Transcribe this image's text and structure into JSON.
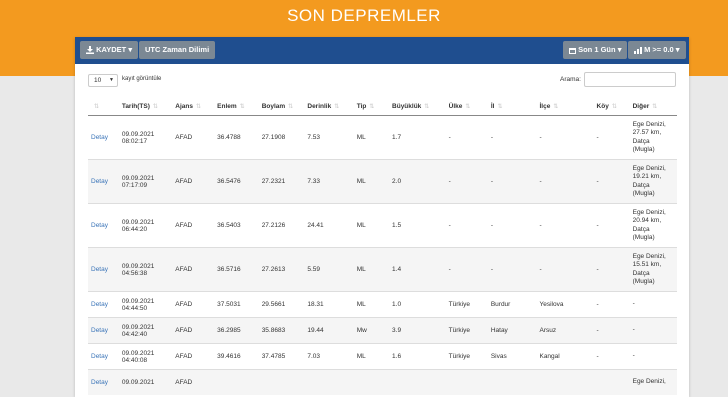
{
  "header": {
    "title": "SON DEPREMLER"
  },
  "toolbar": {
    "save_label": "KAYDET",
    "utc_label": "UTC Zaman Dilimi",
    "time_filter_label": "Son 1 Gün",
    "mag_filter_label": "M >= 0.0"
  },
  "controls": {
    "page_length": "10",
    "page_length_label": "kayıt görüntüle",
    "search_label": "Arama:",
    "search_value": ""
  },
  "table": {
    "columns": [
      "",
      "Tarih(TS)",
      "Ajans",
      "Enlem",
      "Boylam",
      "Derinlik",
      "Tip",
      "Büyüklük",
      "Ülke",
      "İl",
      "İlçe",
      "Köy",
      "Diğer"
    ],
    "rows": [
      {
        "link": "Detay",
        "date": "09.09.2021",
        "time": "08:02:17",
        "agency": "AFAD",
        "lat": "36.4788",
        "lon": "27.1908",
        "depth": "7.53",
        "type": "ML",
        "mag": "1.7",
        "country": "-",
        "province": "-",
        "district": "-",
        "village": "-",
        "other": [
          "Ege Denizi,",
          "27.57 km,",
          "Datça",
          "(Mugla)"
        ]
      },
      {
        "link": "Detay",
        "date": "09.09.2021",
        "time": "07:17:09",
        "agency": "AFAD",
        "lat": "36.5476",
        "lon": "27.2321",
        "depth": "7.33",
        "type": "ML",
        "mag": "2.0",
        "country": "-",
        "province": "-",
        "district": "-",
        "village": "-",
        "other": [
          "Ege Denizi,",
          "19.21 km,",
          "Datça",
          "(Mugla)"
        ]
      },
      {
        "link": "Detay",
        "date": "09.09.2021",
        "time": "06:44:20",
        "agency": "AFAD",
        "lat": "36.5403",
        "lon": "27.2126",
        "depth": "24.41",
        "type": "ML",
        "mag": "1.5",
        "country": "-",
        "province": "-",
        "district": "-",
        "village": "-",
        "other": [
          "Ege Denizi,",
          "20.94 km,",
          "Datça",
          "(Mugla)"
        ]
      },
      {
        "link": "Detay",
        "date": "09.09.2021",
        "time": "04:56:38",
        "agency": "AFAD",
        "lat": "36.5716",
        "lon": "27.2613",
        "depth": "5.59",
        "type": "ML",
        "mag": "1.4",
        "country": "-",
        "province": "-",
        "district": "-",
        "village": "-",
        "other": [
          "Ege Denizi,",
          "15.51 km,",
          "Datça",
          "(Mugla)"
        ]
      },
      {
        "link": "Detay",
        "date": "09.09.2021",
        "time": "04:44:50",
        "agency": "AFAD",
        "lat": "37.5031",
        "lon": "29.5661",
        "depth": "18.31",
        "type": "ML",
        "mag": "1.0",
        "country": "Türkiye",
        "province": "Burdur",
        "district": "Yesilova",
        "village": "-",
        "other": [
          "-"
        ]
      },
      {
        "link": "Detay",
        "date": "09.09.2021",
        "time": "04:42:40",
        "agency": "AFAD",
        "lat": "36.2985",
        "lon": "35.8683",
        "depth": "19.44",
        "type": "Mw",
        "mag": "3.9",
        "country": "Türkiye",
        "province": "Hatay",
        "district": "Arsuz",
        "village": "-",
        "other": [
          "-"
        ]
      },
      {
        "link": "Detay",
        "date": "09.09.2021",
        "time": "04:40:08",
        "agency": "AFAD",
        "lat": "39.4616",
        "lon": "37.4785",
        "depth": "7.03",
        "type": "ML",
        "mag": "1.6",
        "country": "Türkiye",
        "province": "Sivas",
        "district": "Kangal",
        "village": "-",
        "other": [
          "-"
        ]
      },
      {
        "link": "Detay",
        "date": "09.09.2021",
        "time": "",
        "agency": "AFAD",
        "lat": "",
        "lon": "",
        "depth": "",
        "type": "",
        "mag": "",
        "country": "",
        "province": "",
        "district": "",
        "village": "",
        "other": [
          "Ege Denizi,"
        ]
      }
    ]
  }
}
